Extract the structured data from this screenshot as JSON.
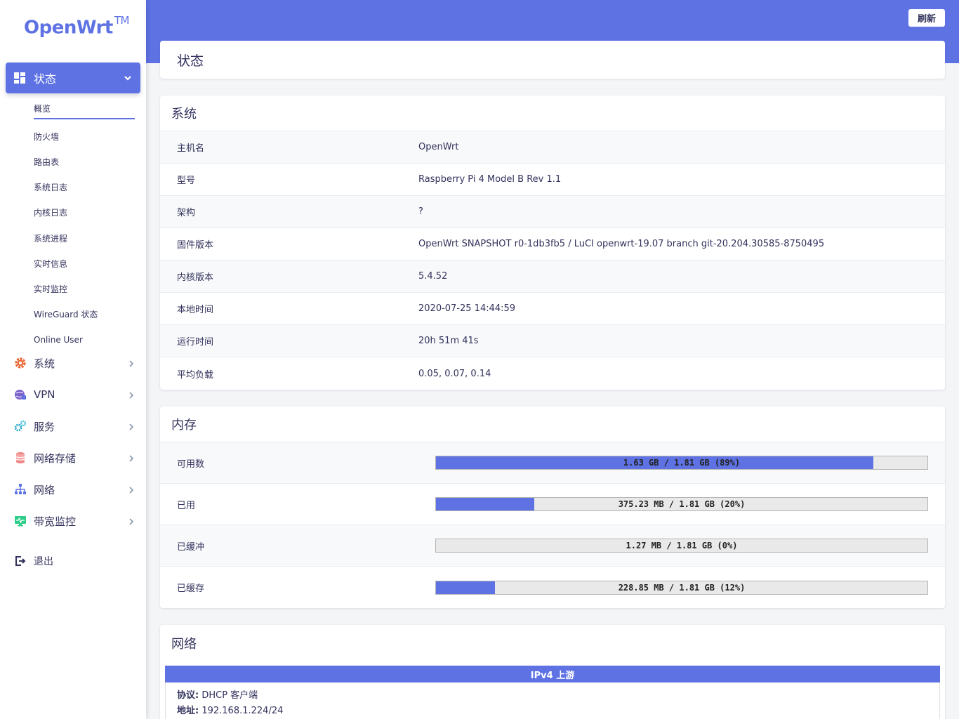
{
  "sidebar": {
    "logo": "OpenWrt",
    "logo_tm": "TM",
    "active_menu": "状态",
    "submenu": [
      "概览",
      "防火墙",
      "路由表",
      "系统日志",
      "内核日志",
      "系统进程",
      "实时信息",
      "实时监控",
      "WireGuard 状态",
      "Online User"
    ],
    "menu": [
      {
        "label": "系统",
        "icon": "gear-icon",
        "color": "#e8622c"
      },
      {
        "label": "VPN",
        "icon": "globe-lock-icon",
        "color": "#7b63c9"
      },
      {
        "label": "服务",
        "icon": "cogs-icon",
        "color": "#1aa6c6"
      },
      {
        "label": "网络存储",
        "icon": "database-icon",
        "color": "#f08585"
      },
      {
        "label": "网络",
        "icon": "network-icon",
        "color": "#5e72e4"
      },
      {
        "label": "带宽监控",
        "icon": "monitor-icon",
        "color": "#2dce89"
      }
    ],
    "logout": "退出"
  },
  "header": {
    "refresh_label": "刷新",
    "page_title": "状态",
    "accent": "#5e72e4"
  },
  "system": {
    "title": "系统",
    "rows": [
      {
        "label": "主机名",
        "value": "OpenWrt"
      },
      {
        "label": "型号",
        "value": "Raspberry Pi 4 Model B Rev 1.1"
      },
      {
        "label": "架构",
        "value": "?"
      },
      {
        "label": "固件版本",
        "value": "OpenWrt SNAPSHOT r0-1db3fb5 / LuCI openwrt-19.07 branch git-20.204.30585-8750495"
      },
      {
        "label": "内核版本",
        "value": "5.4.52"
      },
      {
        "label": "本地时间",
        "value": "2020-07-25 14:44:59"
      },
      {
        "label": "运行时间",
        "value": "20h 51m 41s"
      },
      {
        "label": "平均负载",
        "value": "0.05, 0.07, 0.14"
      }
    ]
  },
  "memory": {
    "title": "内存",
    "rows": [
      {
        "label": "可用数",
        "text": "1.63 GB / 1.81 GB (89%)",
        "percent": 89
      },
      {
        "label": "已用",
        "text": "375.23 MB / 1.81 GB (20%)",
        "percent": 20
      },
      {
        "label": "已缓冲",
        "text": "1.27 MB / 1.81 GB (0%)",
        "percent": 0
      },
      {
        "label": "已缓存",
        "text": "228.85 MB / 1.81 GB (12%)",
        "percent": 12
      }
    ]
  },
  "network": {
    "title": "网络",
    "ipv4_header": "IPv4 上游",
    "protocol_label": "协议:",
    "protocol_value": "DHCP 客户端",
    "address_label": "地址:",
    "address_value": "192.168.1.224/24"
  }
}
